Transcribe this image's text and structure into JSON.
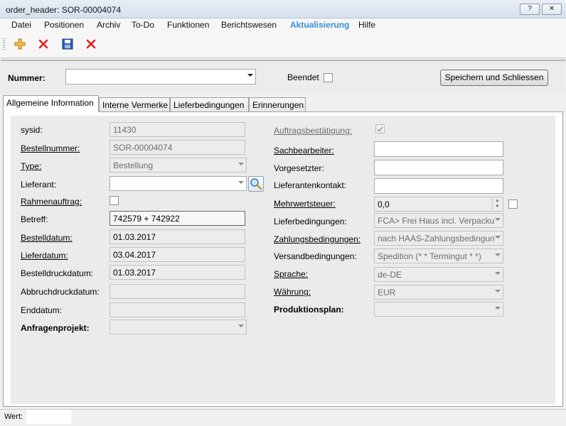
{
  "window": {
    "title": "order_header: SOR-00004074",
    "help_btn": "?",
    "close_btn": "✕"
  },
  "menu": [
    "Datei",
    "Positionen",
    "Archiv",
    "To-Do",
    "Funktionen",
    "Berichtswesen",
    "Aktualisierung",
    "Hilfe"
  ],
  "toolbar": {
    "icons": [
      "add-icon",
      "delete-icon",
      "save-icon",
      "cancel-icon"
    ],
    "accent": "#e8a400",
    "danger": "#e0241c",
    "save_color": "#2a5db0"
  },
  "header": {
    "nummer_label": "Nummer:",
    "nummer_value": "",
    "beendet_label": "Beendet",
    "save_close_label": "Speichern und Schliessen"
  },
  "tabs": [
    "Allgemeine Information",
    "Interne Vermerke",
    "Lieferbedingungen",
    "Erinnerungen"
  ],
  "left": {
    "sysid_label": "sysid:",
    "sysid_value": "11430",
    "bestellnummer_label": "Bestellnummer:",
    "bestellnummer_value": "SOR-00004074",
    "type_label": "Type:",
    "type_value": "Bestellung",
    "lieferant_label": "Lieferant:",
    "lieferant_value": "",
    "rahmen_label": "Rahmenauftrag:",
    "betreff_label": "Betreff:",
    "betreff_value": "742579 + 742922",
    "bestelldatum_label": "Bestelldatum:",
    "bestelldatum_value": "01.03.2017",
    "lieferdatum_label": "Lieferdatum:",
    "lieferdatum_value": "03.04.2017",
    "druckdatum_label": "Bestelldruckdatum:",
    "druckdatum_value": "01.03.2017",
    "abbruch_label": "Abbruchdruckdatum:",
    "abbruch_value": "",
    "enddatum_label": "Enddatum:",
    "enddatum_value": "",
    "anfragen_label": "Anfragenprojekt:",
    "anfragen_value": ""
  },
  "right": {
    "auftrag_label": "Auftragsbestätigung:",
    "sachbearbeiter_label": "Sachbearbeiter:",
    "sachbearbeiter_value": "",
    "vorgesetzter_label": "Vorgesetzter:",
    "vorgesetzter_value": "",
    "kontakt_label": "Lieferantenkontakt:",
    "kontakt_value": "",
    "mwst_label": "Mehrwertsteuer:",
    "mwst_value": "0,0",
    "lieferbed_label": "Lieferbedingungen:",
    "lieferbed_value": "FCA> Frei Haus incl. Verpacku",
    "zahlung_label": "Zahlungsbedingungen:",
    "zahlung_value": "nach HAAS-Zahlungsbedingun",
    "versand_label": "Versandbedingungen:",
    "versand_value": "Spedition (* * Termingut * *)",
    "sprache_label": "Sprache:",
    "sprache_value": "de-DE",
    "waehrung_label": "Währung:",
    "waehrung_value": "EUR",
    "produktion_label": "Produktionsplan:",
    "produktion_value": ""
  },
  "status": {
    "wert_label": "Wert:",
    "wert_value": ""
  }
}
